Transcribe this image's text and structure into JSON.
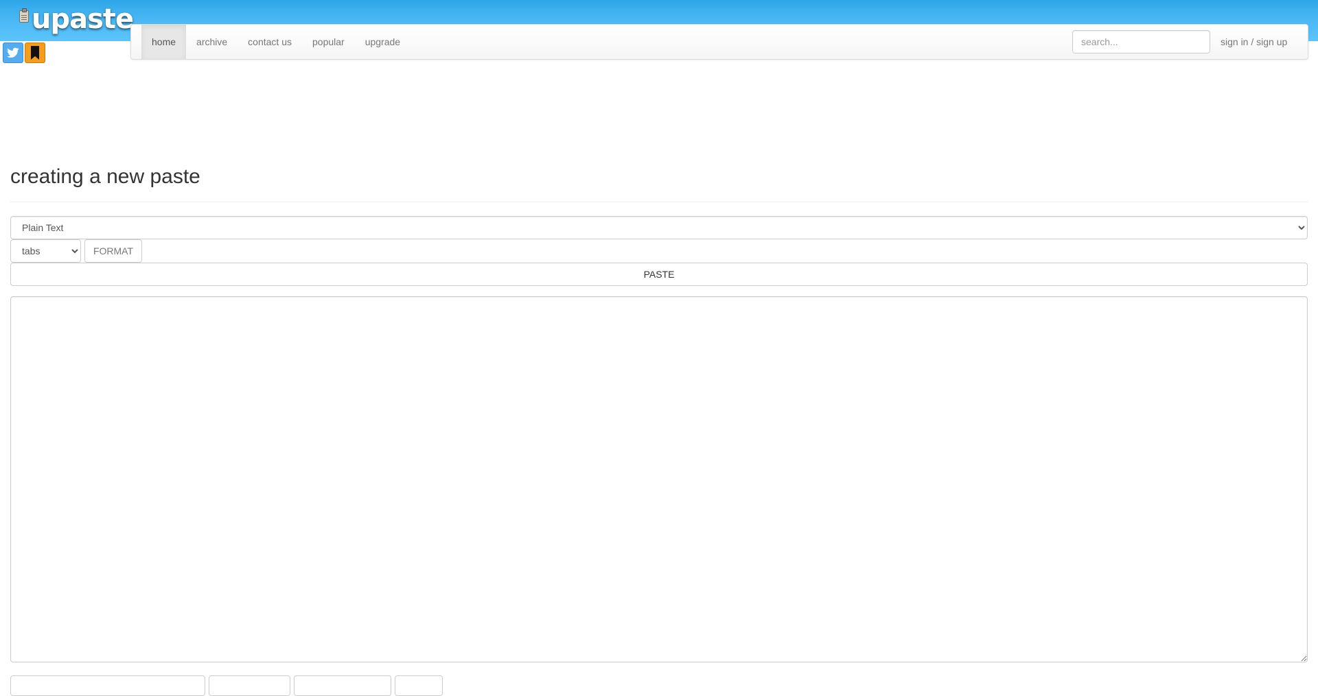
{
  "app": {
    "logo_text": "upaste"
  },
  "social": {
    "twitter_icon": "twitter-bird-icon",
    "bookmark_icon": "bookmark-icon",
    "twitter_color": "#55acee",
    "bookmark_color": "#f59e1b"
  },
  "navbar": {
    "links": [
      {
        "label": "home",
        "active": true
      },
      {
        "label": "archive",
        "active": false
      },
      {
        "label": "contact us",
        "active": false
      },
      {
        "label": "popular",
        "active": false
      },
      {
        "label": "upgrade",
        "active": false
      }
    ],
    "search_placeholder": "search...",
    "search_value": "",
    "signin_label": "sign in / sign up"
  },
  "main": {
    "title": "creating a new paste",
    "language_select": {
      "selected": "Plain Text"
    },
    "indent_select": {
      "selected": "tabs"
    },
    "format_button": "FORMAT",
    "paste_button": "PASTE",
    "paste_content": ""
  },
  "colors": {
    "header_gradient_top": "#2fa6e8",
    "header_gradient_bottom": "#5cc4fb",
    "active_nav_bg": "#e7e7e7"
  }
}
